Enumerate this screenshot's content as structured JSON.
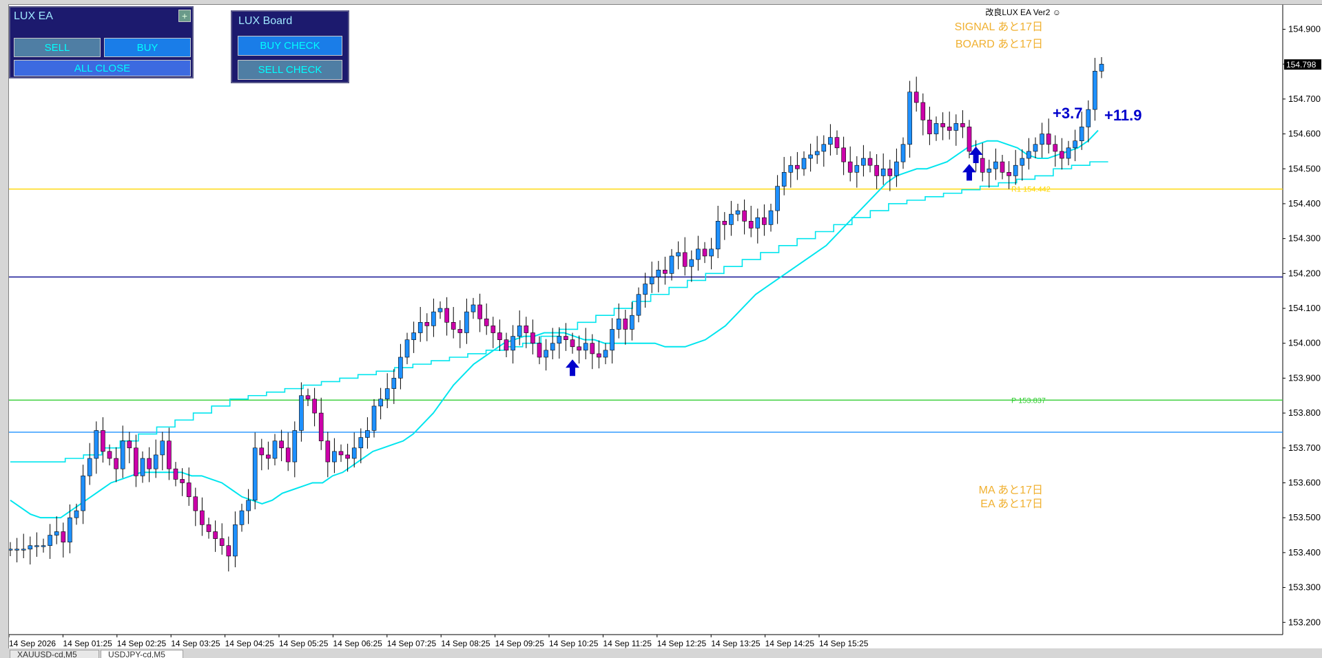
{
  "chart_data": {
    "type": "candlestick",
    "symbol_tab": "USDJPY-cd,M5",
    "current_price": "154.798",
    "y_ticks": [
      "154.900",
      "154.800",
      "154.700",
      "154.600",
      "154.500",
      "154.400",
      "154.300",
      "154.200",
      "154.100",
      "154.000",
      "153.900",
      "153.800",
      "153.700",
      "153.600",
      "153.500",
      "153.400",
      "153.300",
      "153.200"
    ],
    "y_range": [
      153.165,
      154.97
    ],
    "x_labels": [
      "14 Sep 2026",
      "14 Sep 01:25",
      "14 Sep 02:25",
      "14 Sep 03:25",
      "14 Sep 04:25",
      "14 Sep 05:25",
      "14 Sep 06:25",
      "14 Sep 07:25",
      "14 Sep 08:25",
      "14 Sep 09:25",
      "14 Sep 10:25",
      "14 Sep 11:25",
      "14 Sep 12:25",
      "14 Sep 13:25",
      "14 Sep 14:25",
      "14 Sep 15:25"
    ],
    "closes": [
      153.41,
      153.41,
      153.41,
      153.42,
      153.42,
      153.42,
      153.45,
      153.46,
      153.43,
      153.5,
      153.52,
      153.62,
      153.67,
      153.75,
      153.69,
      153.67,
      153.64,
      153.72,
      153.7,
      153.62,
      153.67,
      153.64,
      153.68,
      153.72,
      153.64,
      153.61,
      153.6,
      153.56,
      153.52,
      153.48,
      153.46,
      153.44,
      153.42,
      153.39,
      153.48,
      153.52,
      153.55,
      153.7,
      153.68,
      153.67,
      153.72,
      153.7,
      153.66,
      153.75,
      153.85,
      153.84,
      153.8,
      153.72,
      153.66,
      153.69,
      153.68,
      153.67,
      153.7,
      153.73,
      153.75,
      153.82,
      153.84,
      153.87,
      153.9,
      153.96,
      154.01,
      154.03,
      154.06,
      154.05,
      154.09,
      154.1,
      154.06,
      154.04,
      154.03,
      154.09,
      154.11,
      154.07,
      154.05,
      154.03,
      154.01,
      153.98,
      154.02,
      154.05,
      154.03,
      154.0,
      153.96,
      153.98,
      154.0,
      154.02,
      154.01,
      153.99,
      153.98,
      154.0,
      153.97,
      153.96,
      153.98,
      154.04,
      154.07,
      154.04,
      154.08,
      154.14,
      154.17,
      154.19,
      154.21,
      154.2,
      154.25,
      154.26,
      154.22,
      154.24,
      154.27,
      154.25,
      154.27,
      154.35,
      154.34,
      154.37,
      154.38,
      154.35,
      154.33,
      154.36,
      154.34,
      154.38,
      154.45,
      154.49,
      154.51,
      154.5,
      154.53,
      154.54,
      154.55,
      154.57,
      154.59,
      154.56,
      154.52,
      154.49,
      154.51,
      154.53,
      154.51,
      154.48,
      154.5,
      154.48,
      154.52,
      154.57,
      154.72,
      154.69,
      154.64,
      154.6,
      154.63,
      154.62,
      154.61,
      154.63,
      154.62,
      154.55,
      154.53,
      154.49,
      154.5,
      154.52,
      154.49,
      154.48,
      154.51,
      154.53,
      154.55,
      154.57,
      154.6,
      154.57,
      154.55,
      154.53,
      154.56,
      154.58,
      154.62,
      154.67,
      154.78,
      154.8
    ],
    "ma_fast": [
      153.55,
      153.53,
      153.51,
      153.5,
      153.5,
      153.5,
      153.52,
      153.54,
      153.56,
      153.58,
      153.6,
      153.61,
      153.62,
      153.63,
      153.63,
      153.63,
      153.63,
      153.63,
      153.62,
      153.62,
      153.61,
      153.6,
      153.58,
      153.56,
      153.55,
      153.54,
      153.55,
      153.57,
      153.58,
      153.59,
      153.6,
      153.6,
      153.62,
      153.63,
      153.65,
      153.67,
      153.69,
      153.7,
      153.71,
      153.72,
      153.74,
      153.77,
      153.8,
      153.84,
      153.88,
      153.91,
      153.94,
      153.96,
      153.98,
      154.0,
      154.01,
      154.02,
      154.02,
      154.03,
      154.03,
      154.03,
      154.02,
      154.01,
      154.01,
      154.0,
      154.0,
      154.0,
      154.0,
      154.0,
      154.0,
      153.99,
      153.99,
      153.99,
      154.0,
      154.01,
      154.03,
      154.05,
      154.08,
      154.11,
      154.14,
      154.16,
      154.18,
      154.2,
      154.22,
      154.24,
      154.26,
      154.28,
      154.31,
      154.34,
      154.37,
      154.4,
      154.43,
      154.46,
      154.48,
      154.49,
      154.5,
      154.5,
      154.51,
      154.52,
      154.54,
      154.56,
      154.57,
      154.58,
      154.58,
      154.57,
      154.56,
      154.54,
      154.53,
      154.53,
      154.54,
      154.55,
      154.56,
      154.58,
      154.61
    ],
    "ma_slow": [
      153.66,
      153.66,
      153.66,
      153.67,
      153.68,
      153.7,
      153.72,
      153.74,
      153.76,
      153.78,
      153.8,
      153.82,
      153.84,
      153.85,
      153.86,
      153.87,
      153.88,
      153.89,
      153.9,
      153.91,
      153.92,
      153.93,
      153.94,
      153.95,
      153.96,
      153.97,
      153.98,
      153.99,
      154.0,
      154.02,
      154.04,
      154.06,
      154.08,
      154.1,
      154.12,
      154.14,
      154.16,
      154.18,
      154.2,
      154.22,
      154.24,
      154.26,
      154.28,
      154.3,
      154.32,
      154.34,
      154.36,
      154.38,
      154.4,
      154.41,
      154.42,
      154.43,
      154.44,
      154.45,
      154.46,
      154.47,
      154.48,
      154.5,
      154.51,
      154.52
    ],
    "lines": [
      {
        "label": "R1 154.442",
        "value": 154.442,
        "color": "#ffd700"
      },
      {
        "label": "P 153.837",
        "value": 153.837,
        "color": "#32cd32"
      },
      {
        "value": 154.19,
        "color": "#00008b"
      },
      {
        "value": 153.745,
        "color": "#1e90ff"
      }
    ],
    "arrows": [
      {
        "bar": 85,
        "value": 153.93
      },
      {
        "bar": 145,
        "value": 154.49
      },
      {
        "bar": 146,
        "value": 154.54
      }
    ]
  },
  "panels": {
    "ea": {
      "title": "LUX EA",
      "plus": "+",
      "sell": "SELL",
      "buy": "BUY",
      "all_close": "ALL CLOSE"
    },
    "board": {
      "title": "LUX Board",
      "buy_check": "BUY CHECK",
      "sell_check": "SELL CHECK"
    }
  },
  "overlay": {
    "header": "改良LUX EA Ver2 ☺",
    "signal": "SIGNAL あと17日",
    "board": "BOARD あと17日",
    "ma": "MA あと17日",
    "ea": "EA あと17日",
    "pips1": "+3.7",
    "pips2": "+11.9"
  },
  "tabs": [
    "XAUUSD-cd,M5",
    "USDJPY-cd,M5"
  ],
  "colors": {
    "bull": "#1e90ff",
    "bear": "#cc00aa",
    "ma": "#00e5ee",
    "arrow": "#0000cc",
    "panel_bg": "#1c1a6e"
  }
}
